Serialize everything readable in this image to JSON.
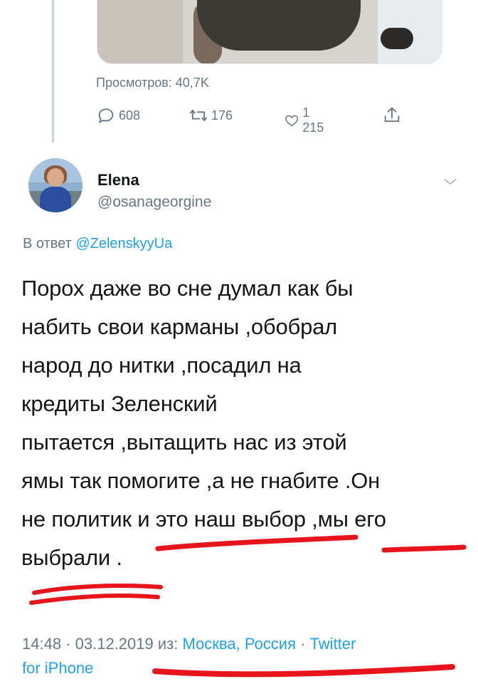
{
  "previous_tweet": {
    "views_text": "Просмотров: 40,7K",
    "stats": {
      "replies": "608",
      "retweets": "176",
      "likes": "1 215"
    }
  },
  "tweet": {
    "author_name": "Elena",
    "author_handle": "@osanageorgine",
    "reply_prefix": "В ответ",
    "reply_to_handle": "@ZelenskyyUa",
    "text": "Порох даже во сне думал как бы\nнабить свои карманы ,обобрал\nнарод до нитки ,посадил на\nкредиты Зеленский\nпытается ,вытащить нас из этой\nямы так помогите ,а не гнабите .Он\nне политик и это наш выбор ,мы его\nвыбрали .",
    "time": "14:48",
    "separator": "·",
    "date": "03.12.2019",
    "from_label": "из:",
    "location": "Москва, Россия",
    "source_line1": "Twitter",
    "source_line2": "for iPhone"
  },
  "icons": {
    "reply": "reply-bubble-icon",
    "retweet": "retweet-icon",
    "like": "heart-icon",
    "share": "share-icon",
    "menu": "chevron-down-icon"
  },
  "colors": {
    "text": "#14171a",
    "secondary": "#657786",
    "link": "#1da1f2",
    "annotation": "#e8141b"
  }
}
